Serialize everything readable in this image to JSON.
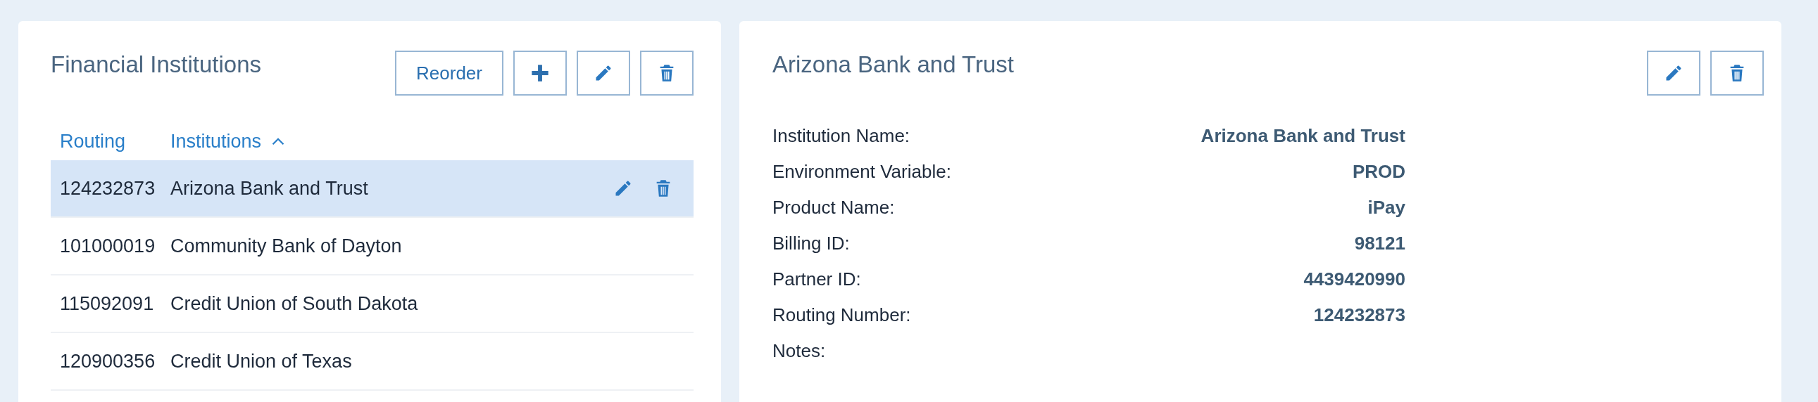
{
  "list_panel": {
    "title": "Financial Institutions",
    "buttons": [
      {
        "kind": "text",
        "label": "Reorder"
      },
      {
        "kind": "add"
      },
      {
        "kind": "edit"
      },
      {
        "kind": "delete"
      }
    ],
    "columns": [
      {
        "label": "Routing",
        "sorted": false
      },
      {
        "label": "Institutions",
        "sorted": true
      }
    ],
    "rows": [
      {
        "routing": "124232873",
        "institution": "Arizona Bank and Trust",
        "selected": true
      },
      {
        "routing": "101000019",
        "institution": "Community Bank of Dayton",
        "selected": false
      },
      {
        "routing": "115092091",
        "institution": "Credit Union of South Dakota",
        "selected": false
      },
      {
        "routing": "120900356",
        "institution": "Credit Union of Texas",
        "selected": false
      }
    ]
  },
  "detail_panel": {
    "title": "Arizona Bank and Trust",
    "buttons": [
      {
        "kind": "edit"
      },
      {
        "kind": "delete"
      }
    ],
    "fields": [
      {
        "label": "Institution Name:",
        "value": "Arizona Bank and Trust"
      },
      {
        "label": "Environment Variable:",
        "value": "PROD"
      },
      {
        "label": "Product Name:",
        "value": "iPay"
      },
      {
        "label": "Billing ID:",
        "value": "98121"
      },
      {
        "label": "Partner ID:",
        "value": "4439420990"
      },
      {
        "label": "Routing Number:",
        "value": "124232873"
      },
      {
        "label": "Notes:"
      }
    ]
  }
}
